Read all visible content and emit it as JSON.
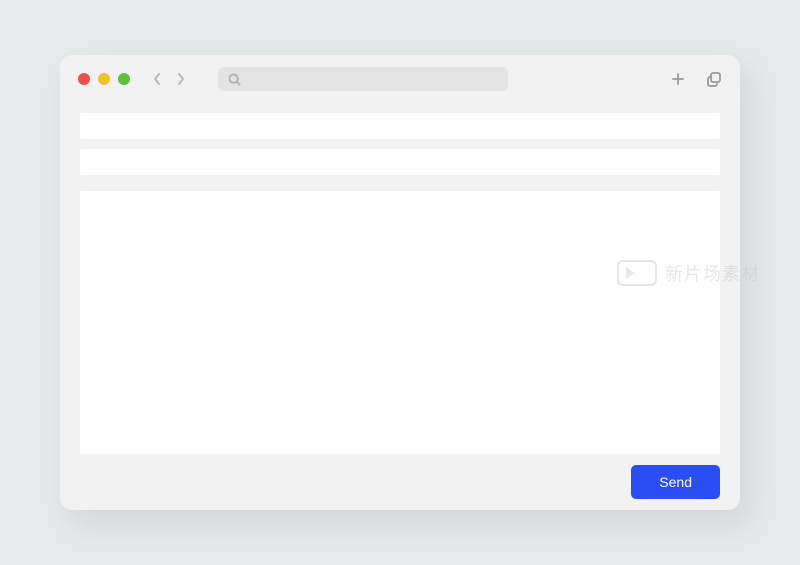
{
  "footer": {
    "send_label": "Send"
  },
  "watermark": {
    "text": "新片场素材"
  }
}
